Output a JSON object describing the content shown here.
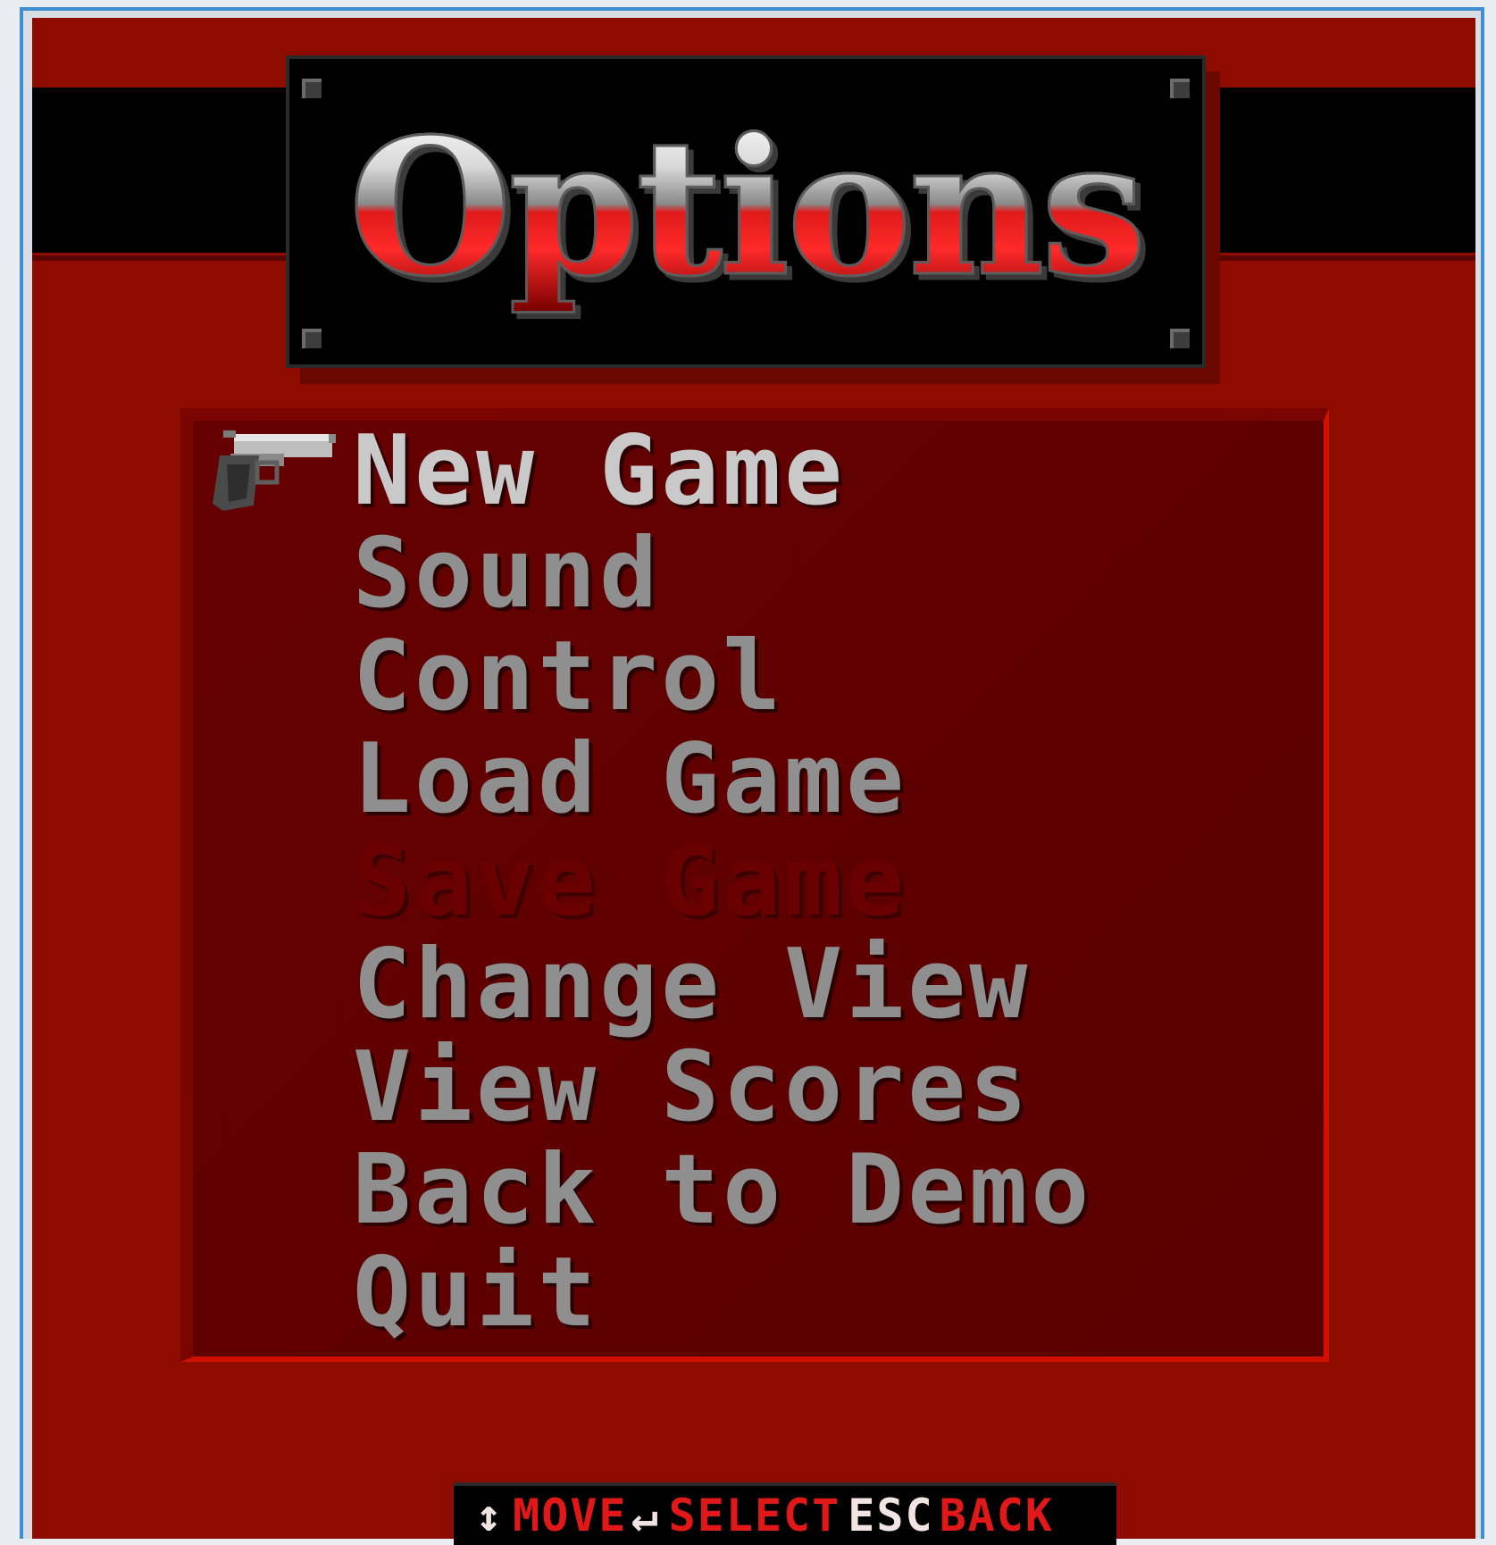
{
  "title": "Options",
  "menu": {
    "items": [
      {
        "label": "New Game",
        "state": "selected"
      },
      {
        "label": "Sound",
        "state": "normal"
      },
      {
        "label": "Control",
        "state": "normal"
      },
      {
        "label": "Load Game",
        "state": "normal"
      },
      {
        "label": "Save Game",
        "state": "disabled"
      },
      {
        "label": "Change View",
        "state": "normal"
      },
      {
        "label": "View Scores",
        "state": "normal"
      },
      {
        "label": "Back to Demo",
        "state": "normal"
      },
      {
        "label": "Quit",
        "state": "normal"
      }
    ],
    "cursor_icon": "pistol-icon"
  },
  "hints": {
    "move_icon": "up-down-arrow-icon",
    "move_label": "MOVE",
    "select_icon": "enter-key-icon",
    "select_label": "SELECT",
    "esc_key": "ESC",
    "back_label": "BACK"
  },
  "colors": {
    "background": "#8e0b00",
    "panel": "#5a0000",
    "item_normal": "#8f8f8f",
    "item_selected": "#c9c9c9",
    "item_disabled": "#6b0000",
    "hint_red": "#e01818"
  }
}
